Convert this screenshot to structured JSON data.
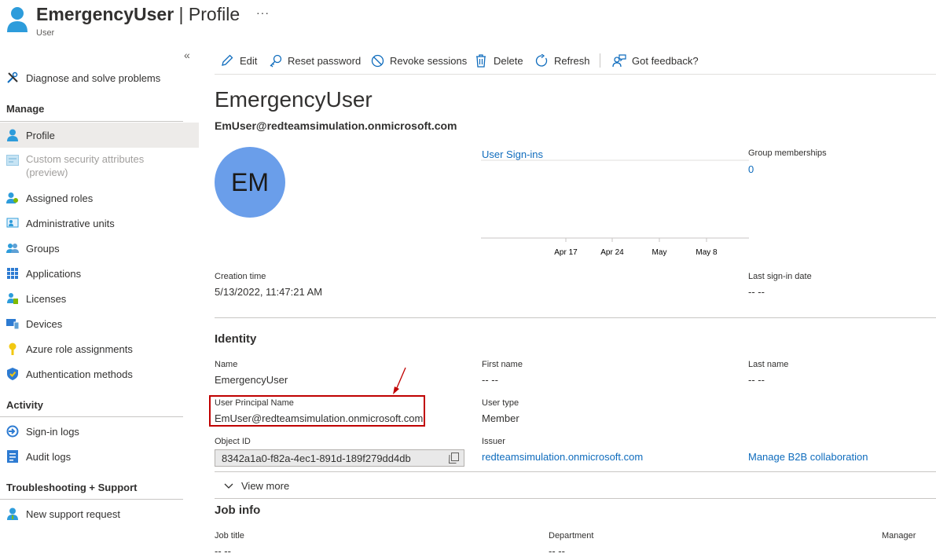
{
  "header": {
    "title": "EmergencyUser",
    "title_sep": " | ",
    "title_page": "Profile",
    "subtitle": "User",
    "more": "···"
  },
  "sidebar": {
    "collapse_icon": "«",
    "diagnose": "Diagnose and solve problems",
    "manage_heading": "Manage",
    "items": [
      {
        "label": "Profile",
        "icon": "user-icon"
      },
      {
        "label": "Custom security attributes",
        "label2": "(preview)",
        "icon": "attributes-icon"
      },
      {
        "label": "Assigned roles",
        "icon": "roles-icon"
      },
      {
        "label": "Administrative units",
        "icon": "admin-units-icon"
      },
      {
        "label": "Groups",
        "icon": "groups-icon"
      },
      {
        "label": "Applications",
        "icon": "applications-icon"
      },
      {
        "label": "Licenses",
        "icon": "licenses-icon"
      },
      {
        "label": "Devices",
        "icon": "devices-icon"
      },
      {
        "label": "Azure role assignments",
        "icon": "key-icon"
      },
      {
        "label": "Authentication methods",
        "icon": "shield-icon"
      }
    ],
    "activity_heading": "Activity",
    "activity": [
      {
        "label": "Sign-in logs",
        "icon": "signin-icon"
      },
      {
        "label": "Audit logs",
        "icon": "audit-icon"
      }
    ],
    "support_heading": "Troubleshooting + Support",
    "support": [
      {
        "label": "New support request",
        "icon": "support-icon"
      }
    ]
  },
  "toolbar": {
    "edit": "Edit",
    "reset_password": "Reset password",
    "revoke_sessions": "Revoke sessions",
    "delete": "Delete",
    "refresh": "Refresh",
    "feedback": "Got feedback?"
  },
  "profile": {
    "display_name": "EmergencyUser",
    "upn": "EmUser@redteamsimulation.onmicrosoft.com",
    "initials": "EM",
    "avatar_color": "#6a9eea",
    "signins_link": "User Sign-ins",
    "signins_ticks": [
      "Apr 17",
      "Apr 24",
      "May",
      "May 8"
    ],
    "group_memberships_label": "Group memberships",
    "group_memberships_value": "0",
    "creation_time_label": "Creation time",
    "creation_time_value": "5/13/2022, 11:47:21 AM",
    "last_signin_label": "Last sign-in date",
    "last_signin_value": "-- --"
  },
  "identity": {
    "title": "Identity",
    "name_label": "Name",
    "name_value": "EmergencyUser",
    "first_name_label": "First name",
    "first_name_value": "-- --",
    "last_name_label": "Last name",
    "last_name_value": "-- --",
    "upn_label": "User Principal Name",
    "upn_value": "EmUser@redteamsimulation.onmicrosoft.com",
    "user_type_label": "User type",
    "user_type_value": "Member",
    "object_id_label": "Object ID",
    "object_id_value": "8342a1a0-f82a-4ec1-891d-189f279dd4db",
    "issuer_label": "Issuer",
    "issuer_value": "redteamsimulation.onmicrosoft.com",
    "b2b_link": "Manage B2B collaboration",
    "view_more": "View more",
    "highlight_color": "#c00000"
  },
  "job": {
    "title": "Job info",
    "job_title_label": "Job title",
    "job_title_value": "-- --",
    "department_label": "Department",
    "department_value": "-- --",
    "manager_label": "Manager"
  },
  "accent_color": "#0f6cbd"
}
